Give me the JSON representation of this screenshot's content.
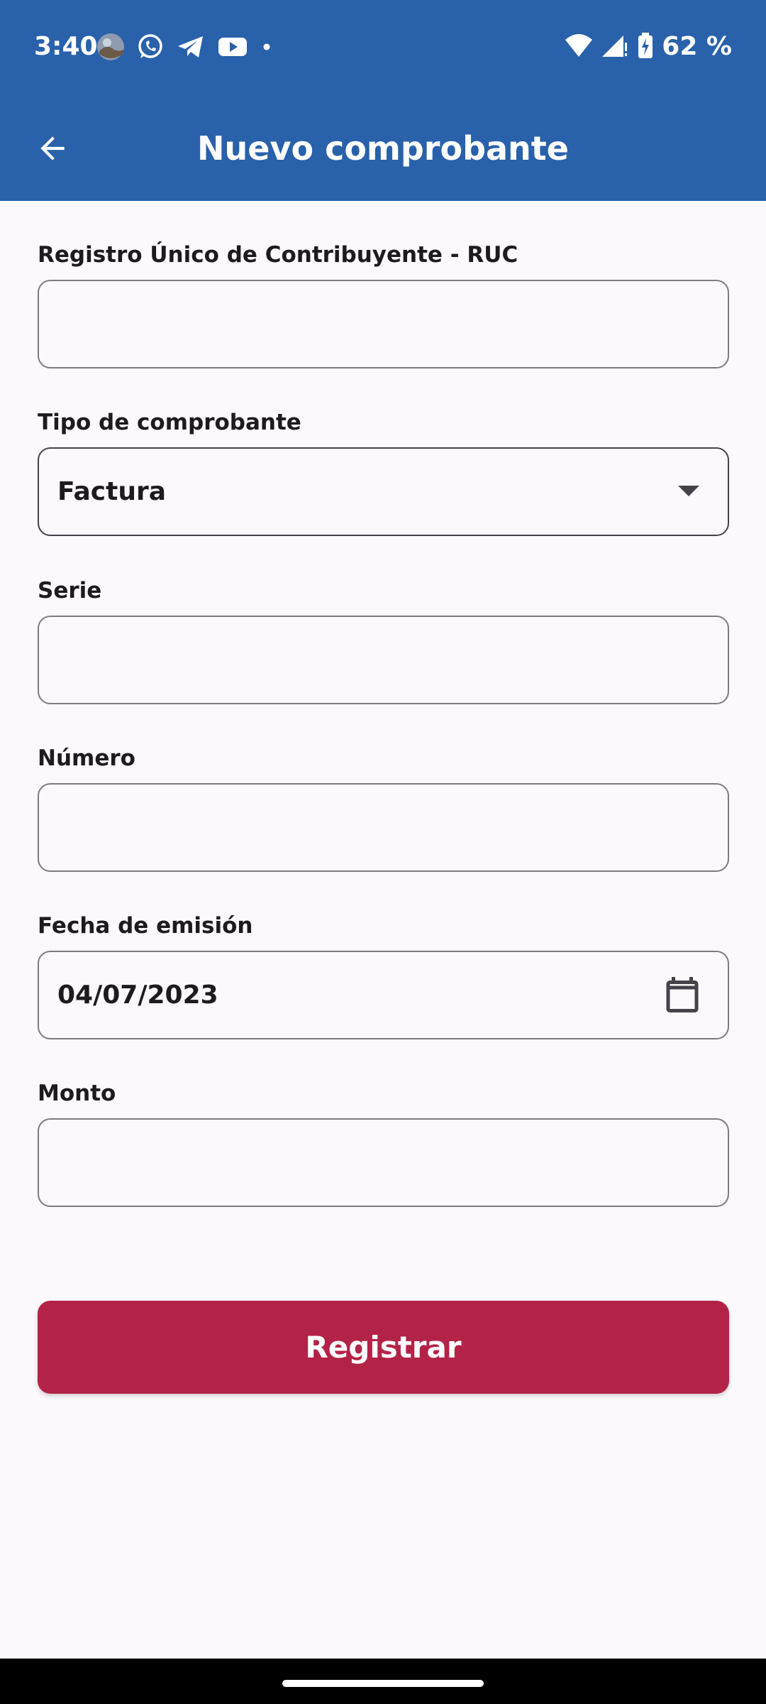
{
  "status_bar": {
    "time": "3:40",
    "battery": "62 %",
    "left_icons": [
      "avatar-icon",
      "whatsapp-icon",
      "telegram-icon",
      "youtube-icon",
      "dot-icon"
    ],
    "right_icons": [
      "wifi-icon",
      "signal-icon",
      "battery-charging-icon"
    ]
  },
  "app_bar": {
    "title": "Nuevo comprobante",
    "back_icon": "arrow-back-icon"
  },
  "form": {
    "ruc": {
      "label": "Registro Único de Contribuyente - RUC",
      "value": ""
    },
    "tipo": {
      "label": "Tipo de comprobante",
      "value": "Factura"
    },
    "serie": {
      "label": "Serie",
      "value": ""
    },
    "numero": {
      "label": "Número",
      "value": ""
    },
    "fecha": {
      "label": "Fecha de emisión",
      "value": "04/07/2023",
      "icon": "calendar-icon"
    },
    "monto": {
      "label": "Monto",
      "value": ""
    }
  },
  "submit_label": "Registrar",
  "colors": {
    "primary": "#2961aa",
    "accent": "#b32347",
    "background": "#fcf9fc",
    "outline": "#7d7a80"
  }
}
